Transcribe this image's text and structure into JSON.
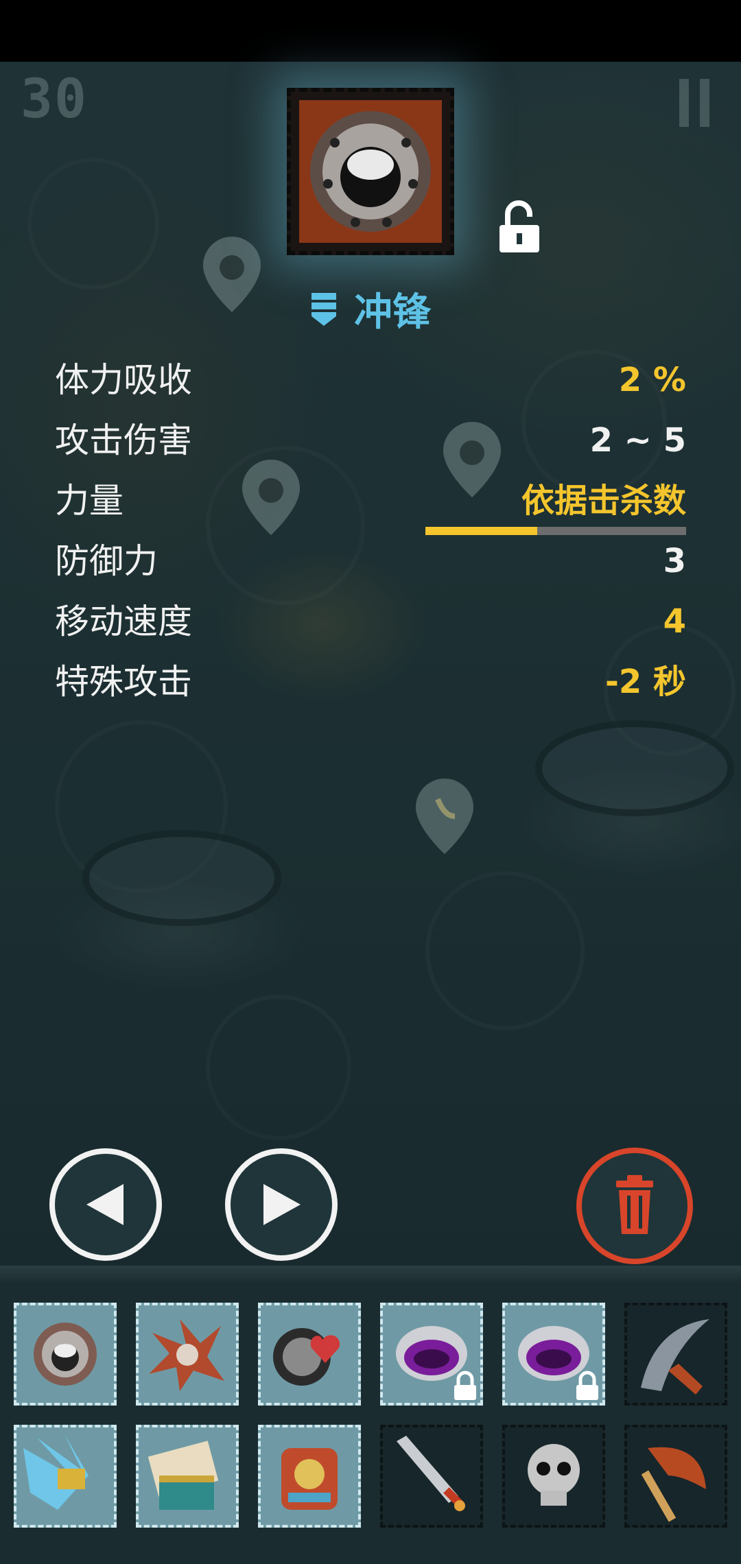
{
  "hud": {
    "counter": "30"
  },
  "item": {
    "name": "冲锋",
    "locked": false
  },
  "stats": [
    {
      "label": "体力吸收",
      "value": "2 %",
      "color": "#f4c52d"
    },
    {
      "label": "攻击伤害",
      "value": "2 ~ 5",
      "color": "#f1f1f1"
    },
    {
      "label": "力量",
      "value": "依据击杀数",
      "color": "#f4c52d"
    },
    {
      "label": "防御力",
      "value": "3",
      "color": "#f1f1f1"
    },
    {
      "label": "移动速度",
      "value": "4",
      "color": "#f4c52d"
    },
    {
      "label": "特殊攻击",
      "value": "-2 秒",
      "color": "#f4c52d"
    }
  ],
  "strength_progress": 0.43,
  "colors": {
    "accent_blue": "#5ec2e6",
    "highlight_yellow": "#f4c52d",
    "delete_red": "#d8452a"
  },
  "controls": {
    "prev_icon": "triangle-left-icon",
    "next_icon": "triangle-right-icon",
    "delete_icon": "trash-icon"
  },
  "inventory": {
    "rows": [
      [
        {
          "icon": "gauntlet-chain-icon",
          "equipped": true,
          "locked": false
        },
        {
          "icon": "spiked-claw-icon",
          "equipped": true,
          "locked": false
        },
        {
          "icon": "heart-shield-icon",
          "equipped": true,
          "locked": false
        },
        {
          "icon": "purple-ring-icon",
          "equipped": true,
          "locked": true
        },
        {
          "icon": "purple-ring-icon",
          "equipped": true,
          "locked": true
        },
        {
          "icon": "curved-blade-icon",
          "equipped": false,
          "locked": false
        }
      ],
      [
        {
          "icon": "crystal-claw-icon",
          "equipped": true,
          "locked": false
        },
        {
          "icon": "cards-chest-icon",
          "equipped": true,
          "locked": false
        },
        {
          "icon": "ornate-armor-icon",
          "equipped": true,
          "locked": false
        },
        {
          "icon": "sword-icon",
          "equipped": false,
          "locked": false
        },
        {
          "icon": "skull-icon",
          "equipped": false,
          "locked": false
        },
        {
          "icon": "axe-icon",
          "equipped": false,
          "locked": false
        }
      ]
    ]
  }
}
